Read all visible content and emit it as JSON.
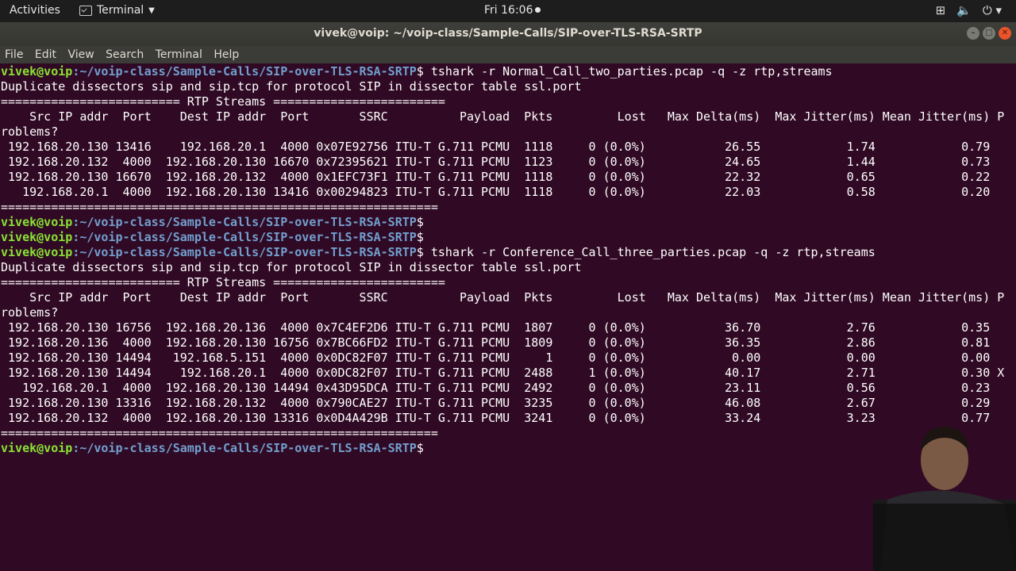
{
  "topbar": {
    "activities": "Activities",
    "app_name": "Terminal",
    "clock": "Fri 16:06",
    "tray_icons": [
      "network-icon",
      "volume-icon",
      "power-icon"
    ]
  },
  "window": {
    "title": "vivek@voip: ~/voip-class/Sample-Calls/SIP-over-TLS-RSA-SRTP",
    "buttons": [
      "minimize",
      "maximize",
      "close"
    ]
  },
  "menu": [
    "File",
    "Edit",
    "View",
    "Search",
    "Terminal",
    "Help"
  ],
  "prompt": {
    "user_host": "vivek@voip",
    "path": ":~/voip-class/Sample-Calls/SIP-over-TLS-RSA-SRTP",
    "symbol": "$"
  },
  "lines": [
    {
      "type": "prompt",
      "cmd": " tshark -r Normal_Call_two_parties.pcap -q -z rtp,streams"
    },
    {
      "type": "text",
      "text": "Duplicate dissectors sip and sip.tcp for protocol SIP in dissector table ssl.port"
    },
    {
      "type": "text",
      "text": "========================= RTP Streams ========================"
    },
    {
      "type": "text",
      "text": "    Src IP addr  Port    Dest IP addr  Port       SSRC          Payload  Pkts         Lost   Max Delta(ms)  Max Jitter(ms) Mean Jitter(ms) P"
    },
    {
      "type": "text",
      "text": "roblems?"
    },
    {
      "type": "text",
      "text": " 192.168.20.130 13416    192.168.20.1  4000 0x07E92756 ITU-T G.711 PCMU  1118     0 (0.0%)           26.55            1.74            0.79"
    },
    {
      "type": "text",
      "text": " 192.168.20.132  4000  192.168.20.130 16670 0x72395621 ITU-T G.711 PCMU  1123     0 (0.0%)           24.65            1.44            0.73"
    },
    {
      "type": "text",
      "text": " 192.168.20.130 16670  192.168.20.132  4000 0x1EFC73F1 ITU-T G.711 PCMU  1118     0 (0.0%)           22.32            0.65            0.22"
    },
    {
      "type": "text",
      "text": "   192.168.20.1  4000  192.168.20.130 13416 0x00294823 ITU-T G.711 PCMU  1118     0 (0.0%)           22.03            0.58            0.20"
    },
    {
      "type": "text",
      "text": "============================================================="
    },
    {
      "type": "prompt",
      "cmd": ""
    },
    {
      "type": "prompt",
      "cmd": ""
    },
    {
      "type": "prompt",
      "cmd": " tshark -r Conference_Call_three_parties.pcap -q -z rtp,streams"
    },
    {
      "type": "text",
      "text": "Duplicate dissectors sip and sip.tcp for protocol SIP in dissector table ssl.port"
    },
    {
      "type": "text",
      "text": "========================= RTP Streams ========================"
    },
    {
      "type": "text",
      "text": "    Src IP addr  Port    Dest IP addr  Port       SSRC          Payload  Pkts         Lost   Max Delta(ms)  Max Jitter(ms) Mean Jitter(ms) P"
    },
    {
      "type": "text",
      "text": "roblems?"
    },
    {
      "type": "text",
      "text": " 192.168.20.130 16756  192.168.20.136  4000 0x7C4EF2D6 ITU-T G.711 PCMU  1807     0 (0.0%)           36.70            2.76            0.35"
    },
    {
      "type": "text",
      "text": " 192.168.20.136  4000  192.168.20.130 16756 0x7BC66FD2 ITU-T G.711 PCMU  1809     0 (0.0%)           36.35            2.86            0.81"
    },
    {
      "type": "text",
      "text": " 192.168.20.130 14494   192.168.5.151  4000 0x0DC82F07 ITU-T G.711 PCMU     1     0 (0.0%)            0.00            0.00            0.00"
    },
    {
      "type": "text",
      "text": " 192.168.20.130 14494    192.168.20.1  4000 0x0DC82F07 ITU-T G.711 PCMU  2488     1 (0.0%)           40.17            2.71            0.30 X"
    },
    {
      "type": "text",
      "text": "   192.168.20.1  4000  192.168.20.130 14494 0x43D95DCA ITU-T G.711 PCMU  2492     0 (0.0%)           23.11            0.56            0.23"
    },
    {
      "type": "text",
      "text": " 192.168.20.130 13316  192.168.20.132  4000 0x790CAE27 ITU-T G.711 PCMU  3235     0 (0.0%)           46.08            2.67            0.29"
    },
    {
      "type": "text",
      "text": " 192.168.20.132  4000  192.168.20.130 13316 0x0D4A429B ITU-T G.711 PCMU  3241     0 (0.0%)           33.24            3.23            0.77"
    },
    {
      "type": "text",
      "text": "============================================================="
    },
    {
      "type": "prompt",
      "cmd": " "
    }
  ],
  "colors": {
    "terminal_bg": "#300a24",
    "prompt_user": "#8ae234",
    "prompt_path": "#729fcf",
    "text": "#ffffff"
  }
}
